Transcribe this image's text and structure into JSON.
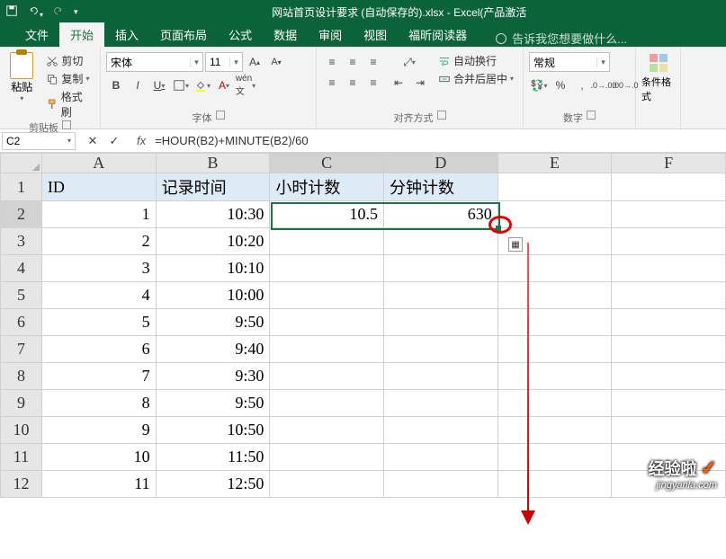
{
  "title": "网站首页设计要求 (自动保存的).xlsx - Excel(产品激活",
  "tabs": {
    "file": "文件",
    "home": "开始",
    "insert": "插入",
    "layout": "页面布局",
    "formula": "公式",
    "data": "数据",
    "review": "审阅",
    "view": "视图",
    "foxit": "福昕阅读器",
    "tell": "告诉我您想要做什么..."
  },
  "clip": {
    "cut": "剪切",
    "copy": "复制",
    "painter": "格式刷",
    "paste": "粘贴",
    "group": "剪贴板"
  },
  "font": {
    "name": "宋体",
    "size": "11",
    "group": "字体"
  },
  "align": {
    "wrap": "自动换行",
    "merge": "合并后居中",
    "group": "对齐方式"
  },
  "number": {
    "fmt": "常规",
    "group": "数字"
  },
  "styles": {
    "cond": "条件格式"
  },
  "namebox": "C2",
  "formula": "=HOUR(B2)+MINUTE(B2)/60",
  "cols": [
    "A",
    "B",
    "C",
    "D",
    "E",
    "F"
  ],
  "rows": [
    "1",
    "2",
    "3",
    "4",
    "5",
    "6",
    "7",
    "8",
    "9",
    "10",
    "11",
    "12"
  ],
  "hdr": {
    "a": "ID",
    "b": "记录时间",
    "c": "小时计数",
    "d": "分钟计数"
  },
  "data": [
    {
      "a": "1",
      "b": "10:30",
      "c": "10.5",
      "d": "630"
    },
    {
      "a": "2",
      "b": "10:20",
      "c": "",
      "d": ""
    },
    {
      "a": "3",
      "b": "10:10",
      "c": "",
      "d": ""
    },
    {
      "a": "4",
      "b": "10:00",
      "c": "",
      "d": ""
    },
    {
      "a": "5",
      "b": "9:50",
      "c": "",
      "d": ""
    },
    {
      "a": "6",
      "b": "9:40",
      "c": "",
      "d": ""
    },
    {
      "a": "7",
      "b": "9:30",
      "c": "",
      "d": ""
    },
    {
      "a": "8",
      "b": "9:50",
      "c": "",
      "d": ""
    },
    {
      "a": "9",
      "b": "10:50",
      "c": "",
      "d": ""
    },
    {
      "a": "10",
      "b": "11:50",
      "c": "",
      "d": ""
    },
    {
      "a": "11",
      "b": "12:50",
      "c": "",
      "d": ""
    }
  ],
  "watermark": {
    "big": "经验啦",
    "small": "jingyanla.com"
  }
}
